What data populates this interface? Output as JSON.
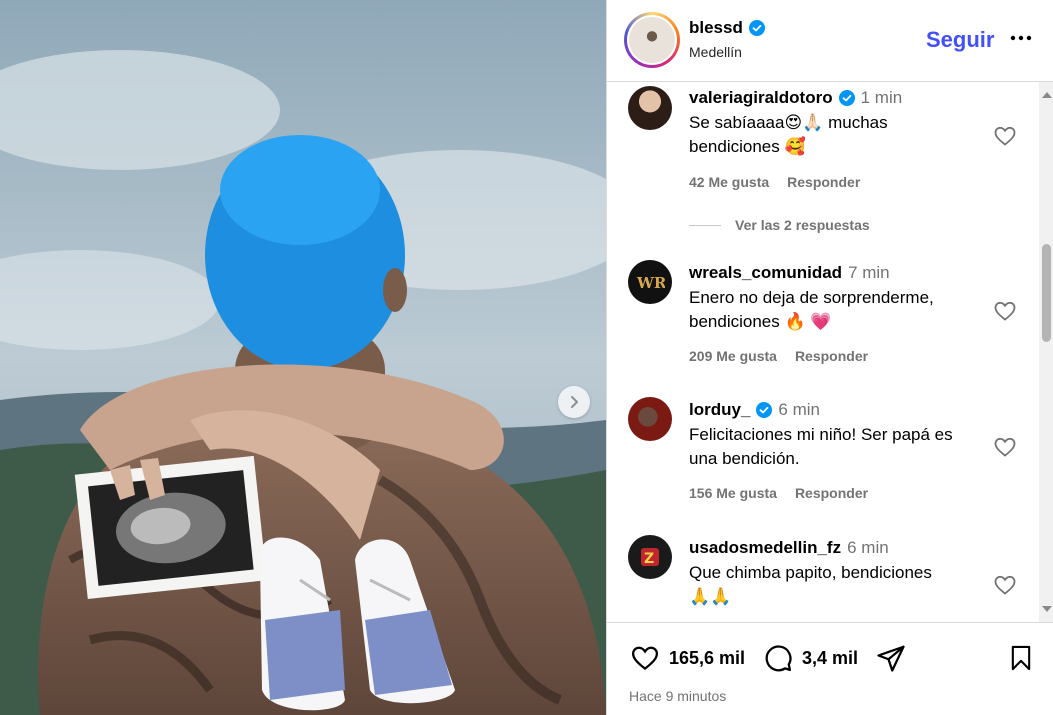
{
  "post": {
    "username": "blessd",
    "location": "Medellín",
    "follow_label": "Seguir",
    "more_icon": "more-horizontal-icon",
    "verified_color": "#0095f6",
    "accent_color": "#4150f7"
  },
  "comments": [
    {
      "username": "valeriagiraldotoro",
      "verified": true,
      "time": "1 min",
      "text_line1": "Se sabíaaaa😍🙏🏻 muchas",
      "text_line2": "bendiciones 🥰",
      "likes": "42 Me gusta",
      "reply_label": "Responder",
      "view_replies": "Ver las 2 respuestas"
    },
    {
      "username": "wreals_comunidad",
      "verified": false,
      "time": "7 min",
      "text_line1": "Enero no deja de sorprenderme,",
      "text_line2": "bendiciones 🔥 💗",
      "likes": "209 Me gusta",
      "reply_label": "Responder"
    },
    {
      "username": "lorduy_",
      "verified": true,
      "time": "6 min",
      "text_line1": "Felicitaciones mi niño! Ser papá es",
      "text_line2": "una bendición.",
      "likes": "156 Me gusta",
      "reply_label": "Responder"
    },
    {
      "username": "usadosmedellin_fz",
      "verified": false,
      "time": "6 min",
      "text_line1": "Que chimba papito, bendiciones",
      "text_line2": "🙏🙏"
    }
  ],
  "actions": {
    "likes_count": "165,6 mil",
    "comments_count": "3,4 mil",
    "posted_ago": "Hace 9 minutos"
  }
}
